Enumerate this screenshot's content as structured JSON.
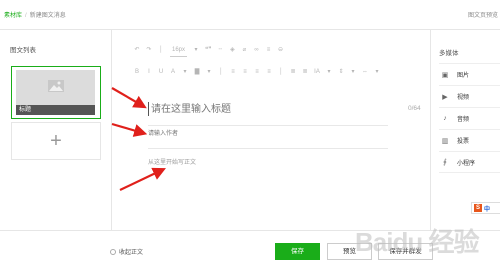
{
  "topbar": {
    "breadcrumb_root": "素材库",
    "breadcrumb_sep": "/",
    "breadcrumb_current": "新建图文消息",
    "preview_link": "图文页预览"
  },
  "left_panel": {
    "title": "图文列表",
    "card_label": "标题",
    "add_symbol": "+"
  },
  "editor": {
    "toolbar_row1": [
      "↶",
      "↷",
      "│",
      "16px",
      "▾",
      "❝❞",
      "╌",
      "◈",
      "⌀",
      "∞",
      "≡",
      "⊖"
    ],
    "toolbar_row2": [
      "B",
      "I",
      "U",
      "A",
      "▾",
      "▇",
      "▾",
      "│",
      "≡",
      "≡",
      "≡",
      "≡",
      "│",
      "≣",
      "≣",
      "IA",
      "▾",
      "⇕",
      "▾",
      "⇔",
      "▾"
    ],
    "title_placeholder": "请在这里输入标题",
    "title_counter": "0/64",
    "author_placeholder": "请输入作者",
    "body_placeholder": "从这里开始写正文"
  },
  "right_panel": {
    "title": "多媒体",
    "items": [
      {
        "icon": "image-icon",
        "glyph": "▣",
        "label": "图片"
      },
      {
        "icon": "video-icon",
        "glyph": "▶",
        "label": "视频"
      },
      {
        "icon": "audio-icon",
        "glyph": "♪",
        "label": "音频"
      },
      {
        "icon": "vote-icon",
        "glyph": "▥",
        "label": "投票"
      },
      {
        "icon": "miniprogram-icon",
        "glyph": "∮",
        "label": "小程序"
      }
    ],
    "ime_badge": "S",
    "ime_label": "中"
  },
  "footer": {
    "original_label": "收起正文",
    "save_label": "保存",
    "preview_label": "预览",
    "save_send_label": "保存并群发"
  },
  "watermark": "Baidu 经验",
  "colors": {
    "accent": "#1aad19",
    "arrow": "#e0201b"
  }
}
